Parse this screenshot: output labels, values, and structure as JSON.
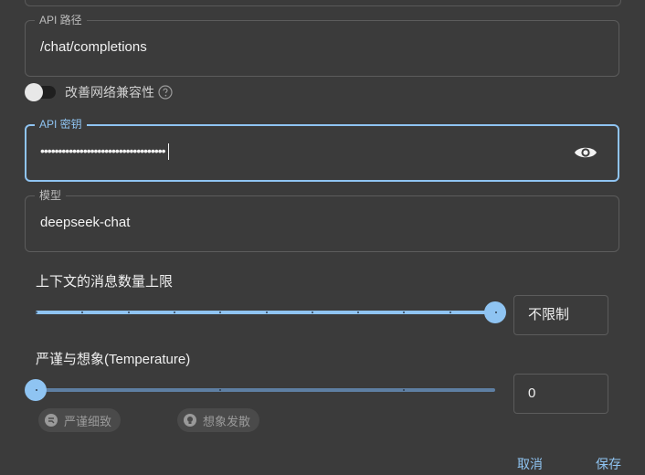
{
  "api_path": {
    "legend": "API 路径",
    "value": "/chat/completions"
  },
  "compat_toggle": {
    "label": "改善网络兼容性",
    "on": false
  },
  "api_key": {
    "legend": "API 密钥",
    "masked_value": "•••••••••••••••••••••••••••••••••••"
  },
  "model": {
    "legend": "模型",
    "value": "deepseek-chat"
  },
  "context_limit": {
    "title": "上下文的消息数量上限",
    "value_label": "不限制",
    "fraction": 1.0,
    "marks": 11
  },
  "temperature": {
    "title": "严谨与想象(Temperature)",
    "value": "0",
    "fraction": 0.0,
    "marks": 3,
    "chips": [
      "严谨细致",
      "想象发散"
    ]
  },
  "actions": {
    "cancel": "取消",
    "save": "保存"
  },
  "colors": {
    "accent": "#8fc4f2",
    "background": "#3b3b3b"
  }
}
